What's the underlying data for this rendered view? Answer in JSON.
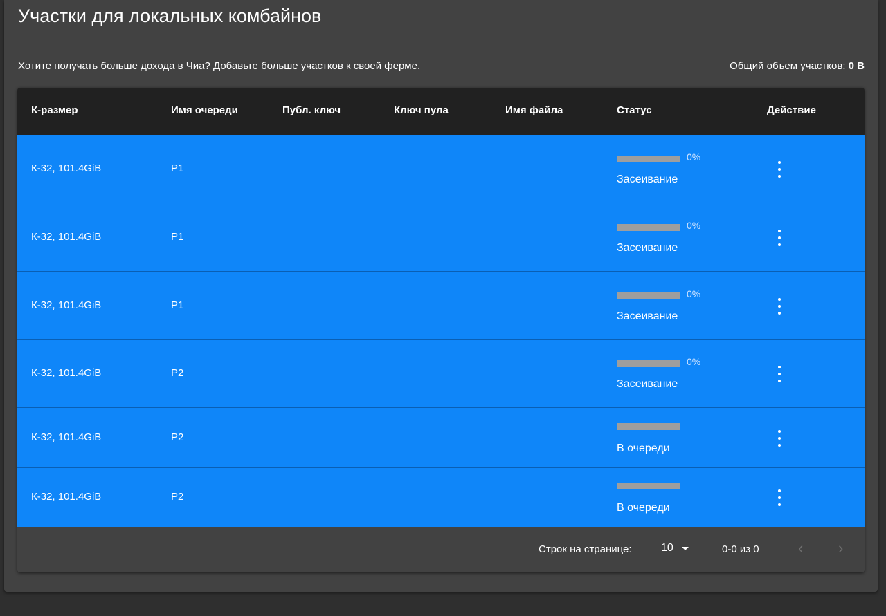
{
  "header": {
    "title": "Участки для локальных комбайнов",
    "subtitle": "Хотите получать больше дохода в Чиа? Добавьте больше участков к своей ферме.",
    "total_label": "Общий объем участков: ",
    "total_value": "0 B"
  },
  "table": {
    "columns": [
      "К-размер",
      "Имя очереди",
      "Публ. ключ",
      "Ключ пула",
      "Имя файла",
      "Статус",
      "Действие"
    ],
    "rows": [
      {
        "k_size": "К-32, 101.4GiB",
        "queue": "P1",
        "progress": 0,
        "progress_label": "0%",
        "status": "Засеивание"
      },
      {
        "k_size": "К-32, 101.4GiB",
        "queue": "P1",
        "progress": 0,
        "progress_label": "0%",
        "status": "Засеивание"
      },
      {
        "k_size": "К-32, 101.4GiB",
        "queue": "P1",
        "progress": 0,
        "progress_label": "0%",
        "status": "Засеивание"
      },
      {
        "k_size": "К-32, 101.4GiB",
        "queue": "P2",
        "progress": 0,
        "progress_label": "0%",
        "status": "Засеивание"
      },
      {
        "k_size": "К-32, 101.4GiB",
        "queue": "P2",
        "progress": 0,
        "progress_label": "",
        "status": "В очереди"
      },
      {
        "k_size": "К-32, 101.4GiB",
        "queue": "P2",
        "progress": 0,
        "progress_label": "",
        "status": "В очереди"
      }
    ],
    "action_icon": "more-vert-icon"
  },
  "footer": {
    "rows_per_page_label": "Строк на странице:",
    "rows_per_page_value": "10",
    "range": "0-0 из 0",
    "prev_icon": "chevron-left-icon",
    "next_icon": "chevron-right-icon"
  },
  "colors": {
    "row_bg": "#0f86f9",
    "header_bg": "#212121",
    "panel_bg": "#424242",
    "page_bg": "#2f2f2f"
  }
}
